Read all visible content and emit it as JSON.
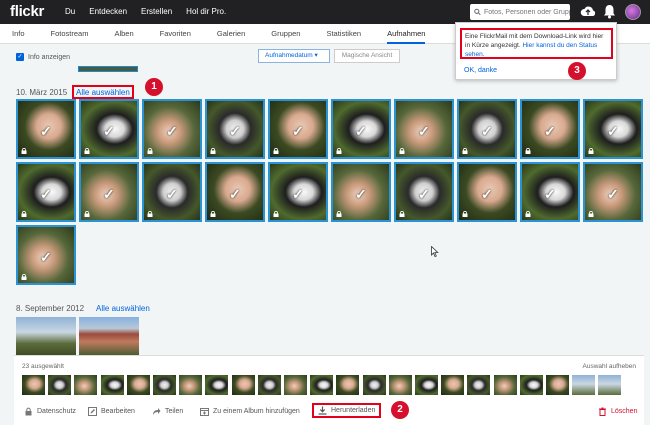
{
  "topbar": {
    "logo": "flickr",
    "nav": [
      "Du",
      "Entdecken",
      "Erstellen",
      "Hol dir Pro."
    ],
    "search_placeholder": "Fotos, Personen oder Gruppen"
  },
  "subnav": {
    "tabs": [
      "Info",
      "Fotostream",
      "Alben",
      "Favoriten",
      "Galerien",
      "Gruppen",
      "Statistiken",
      "Aufnahmen"
    ],
    "active": "Aufnahmen"
  },
  "toolbar": {
    "info_label": "Info anzeigen",
    "sort_label": "Aufnahmedatum",
    "magic_label": "Magische Ansicht"
  },
  "section1": {
    "date": "10. März 2015",
    "select_all": "Alle auswählen",
    "badge": "1"
  },
  "section2": {
    "date": "8. September 2012",
    "select_all": "Alle auswählen"
  },
  "popup": {
    "message": "Eine FlickrMail mit dem Download-Link wird hier in Kürze angezeigt.",
    "link": "Hier kannst du den Status sehen.",
    "ok": "OK, danke",
    "badge": "3"
  },
  "selection": {
    "count": "23 ausgewählt",
    "clear": "Auswahl aufheben"
  },
  "actions": {
    "privacy": "Datenschutz",
    "edit": "Bearbeiten",
    "share": "Teilen",
    "album": "Zu einem Album hinzufügen",
    "download": "Herunterladen",
    "delete": "Löschen",
    "badge": "2"
  },
  "colors": {
    "accent": "#0063dc",
    "highlight": "#e2001a",
    "selection_border": "#2a93d5"
  }
}
